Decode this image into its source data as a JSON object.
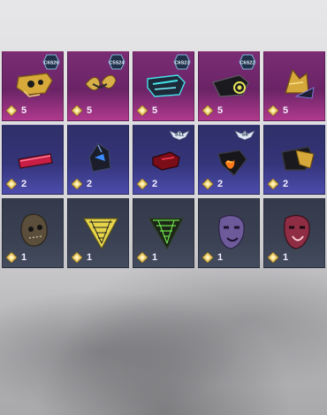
{
  "rows": [
    {
      "theme": "purple",
      "items": [
        {
          "name": "gold-tech-mask",
          "badge": "C6S26",
          "qty": "5"
        },
        {
          "name": "gold-fang-mask",
          "badge": "C5S24",
          "qty": "5"
        },
        {
          "name": "neon-cyber-mask",
          "badge": "C6S23",
          "qty": "5"
        },
        {
          "name": "black-respirator-mask",
          "badge": "C6S22",
          "qty": "5"
        },
        {
          "name": "gold-winged-helmet",
          "badge": "",
          "qty": "5"
        }
      ]
    },
    {
      "theme": "indigo",
      "items": [
        {
          "name": "red-visor-glasses",
          "badge": "",
          "qty": "2"
        },
        {
          "name": "dark-crystal-helmet",
          "badge": "",
          "qty": "2"
        },
        {
          "name": "red-half-mask",
          "badge": "S11",
          "qty": "2"
        },
        {
          "name": "flame-bandana-mask",
          "badge": "S8",
          "qty": "2"
        },
        {
          "name": "gold-wrap-mask",
          "badge": "",
          "qty": "2"
        }
      ]
    },
    {
      "theme": "slate",
      "items": [
        {
          "name": "stitched-sack-mask",
          "badge": "",
          "qty": "1"
        },
        {
          "name": "yellow-net-bandana",
          "badge": "",
          "qty": "1"
        },
        {
          "name": "green-web-bandana",
          "badge": "",
          "qty": "1"
        },
        {
          "name": "purple-theater-mask",
          "badge": "",
          "qty": "1"
        },
        {
          "name": "red-theater-mask",
          "badge": "",
          "qty": "1"
        }
      ]
    }
  ]
}
